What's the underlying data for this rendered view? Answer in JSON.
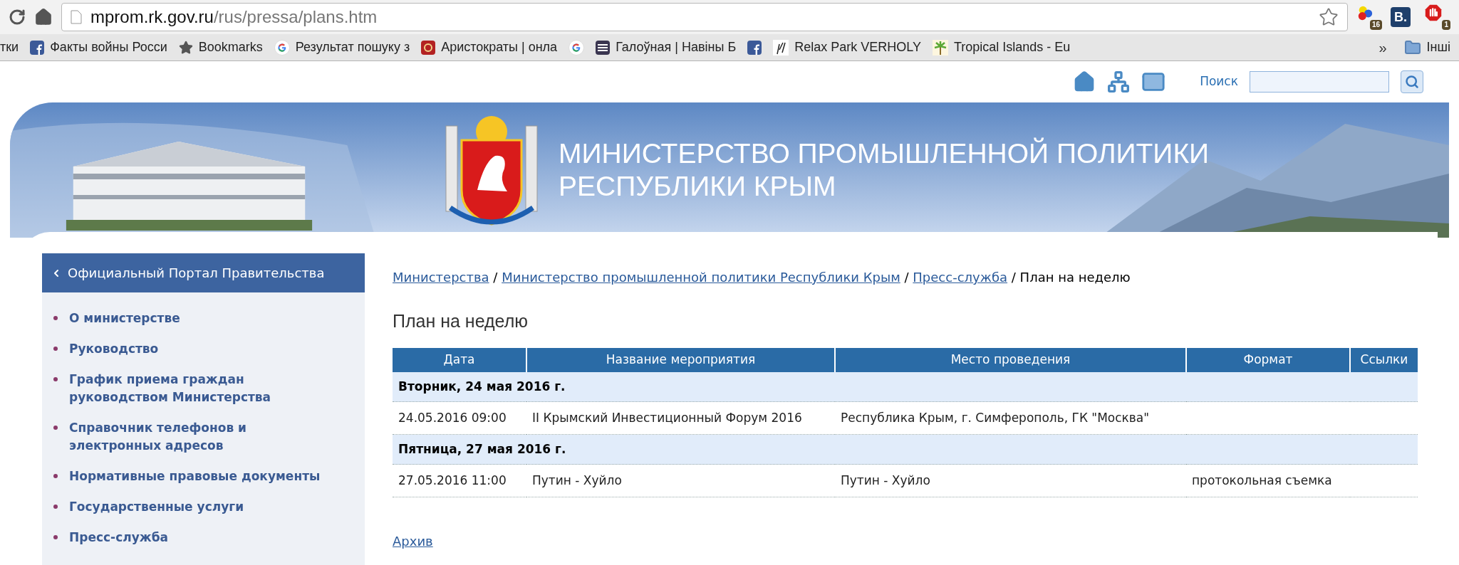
{
  "browser": {
    "url_host": "mprom.rk.gov.ru",
    "url_path": "/rus/pressa/plans.htm",
    "extensions": [
      {
        "kind": "balls",
        "badge": "16"
      },
      {
        "kind": "letter",
        "label": "B."
      },
      {
        "kind": "stop",
        "badge": "1"
      }
    ],
    "bookmarks": [
      {
        "kind": "plain",
        "label": "тки"
      },
      {
        "kind": "facebook",
        "label": "Факты войны Росси"
      },
      {
        "kind": "star",
        "label": "Bookmarks"
      },
      {
        "kind": "google",
        "label": "Результат пошуку з"
      },
      {
        "kind": "emblem",
        "label": "Аристократы | онла"
      },
      {
        "kind": "google"
      },
      {
        "kind": "lines",
        "label": "Галоўная | Навіны Б"
      },
      {
        "kind": "facebook"
      },
      {
        "kind": "sketch",
        "label": "Relax Park VERHOLY"
      },
      {
        "kind": "palm",
        "label": "Tropical Islands - Eu"
      }
    ],
    "overflow": "»",
    "folder": "Інші"
  },
  "site": {
    "search_label": "Поиск",
    "title_lines": [
      "МИНИСТЕРСТВО ПРОМЫШЛЕННОЙ ПОЛИТИКИ",
      "РЕСПУБЛИКИ КРЫМ"
    ]
  },
  "sidebar": {
    "header": "Официальный Портал Правительства",
    "items": [
      "О министерстве",
      "Руководство",
      "График приема граждан руководством Министерства",
      "Справочник телефонов и электронных адресов",
      "Нормативные правовые документы",
      "Государственные услуги",
      "Пресс-служба"
    ]
  },
  "breadcrumb": {
    "separator": "/",
    "links": [
      "Министерства",
      "Министерство промышленной политики Республики Крым",
      "Пресс-служба"
    ],
    "current": "План на неделю"
  },
  "page_title": "План на неделю",
  "table": {
    "columns": [
      "Дата",
      "Название мероприятия",
      "Место проведения",
      "Формат",
      "Ссылки"
    ],
    "groups": [
      {
        "title": "Вторник, 24 мая 2016 г.",
        "rows": [
          [
            "24.05.2016 09:00",
            "II Крымский Инвестиционный Форум 2016",
            "Республика Крым, г. Симферополь, ГК \"Москва\""
          ]
        ]
      },
      {
        "title": "Пятница, 27 мая 2016 г.",
        "rows": [
          [
            "27.05.2016 11:00",
            "Путин - Хуйло",
            "Путин - Хуйло",
            "протокольная съемка"
          ]
        ]
      }
    ]
  },
  "archive_link": "Архив"
}
